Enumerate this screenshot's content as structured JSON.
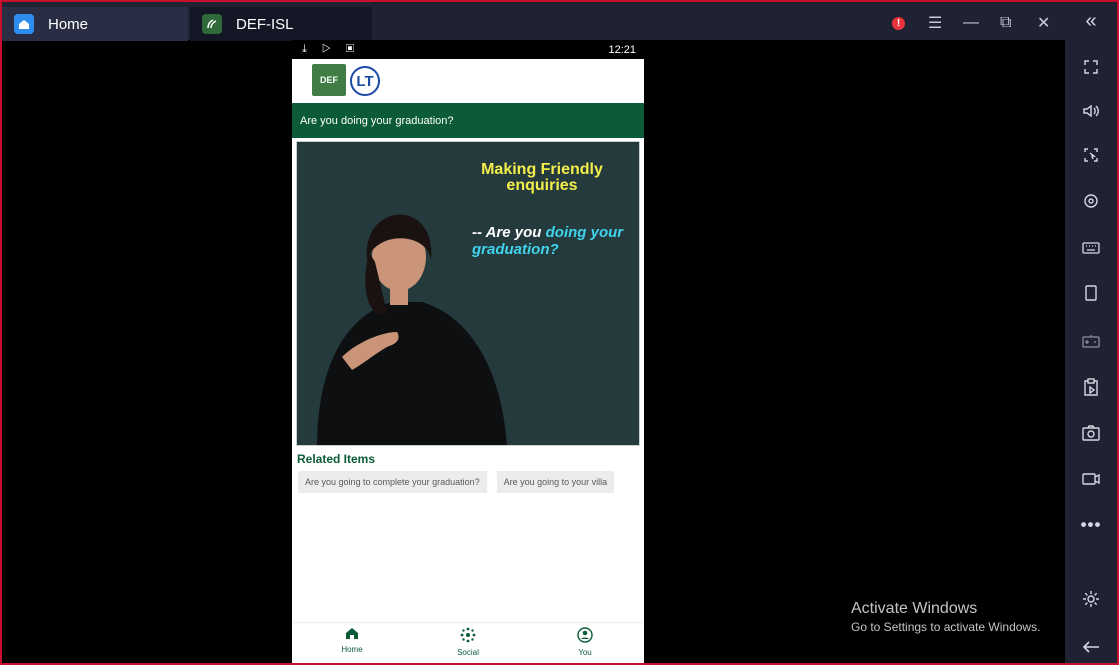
{
  "tabs": [
    {
      "label": "Home"
    },
    {
      "label": "DEF-ISL"
    }
  ],
  "window_controls": {
    "alert": "!",
    "menu": "☰",
    "minimize": "—",
    "restore": "⧉",
    "close": "✕",
    "collapse": "«"
  },
  "phone": {
    "status_time": "12:21",
    "status_icons": "⤓ ▷ ▣",
    "logo_def_text": "DEF",
    "logo_lt_text": "LT",
    "title": "Are you doing your graduation?",
    "video": {
      "headline": "Making Friendly enquiries",
      "caption_prefix": "-- Are you",
      "caption_highlight": "doing your graduation?"
    },
    "related_heading": "Related Items",
    "related_items": [
      "Are you going to complete your graduation?",
      "Are you going to your villa"
    ],
    "nav": [
      {
        "label": "Home",
        "icon": "home-icon"
      },
      {
        "label": "Social",
        "icon": "social-icon"
      },
      {
        "label": "You",
        "icon": "user-icon"
      }
    ]
  },
  "sidebar_icons": [
    "fullscreen-icon",
    "volume-icon",
    "screen-select-icon",
    "eye-icon",
    "keyboard-icon",
    "phone-icon",
    "gamepad-icon",
    "install-apk-icon",
    "screenshot-icon",
    "record-icon",
    "more-icon",
    "settings-icon",
    "back-icon"
  ],
  "watermark": {
    "line1": "Activate Windows",
    "line2": "Go to Settings to activate Windows."
  },
  "colors": {
    "titlebar": "#1f2233",
    "app_green": "#0c5b37",
    "frame_red": "#c8102e"
  }
}
